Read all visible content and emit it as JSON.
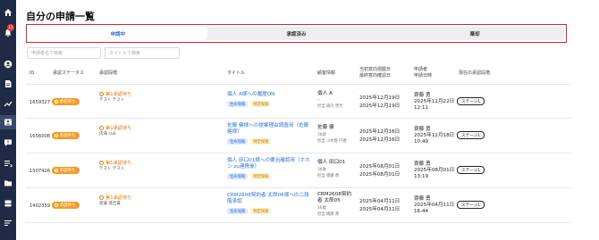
{
  "sidebar": {
    "notification_count": "11",
    "items": [
      {
        "icon": "home-icon"
      },
      {
        "icon": "bell-icon"
      },
      {
        "icon": "user-circle-icon"
      },
      {
        "icon": "document-icon"
      },
      {
        "icon": "trend-chart-icon"
      },
      {
        "icon": "person-card-icon"
      },
      {
        "icon": "chat-alert-icon"
      },
      {
        "icon": "list-icon"
      },
      {
        "icon": "folder-icon"
      },
      {
        "icon": "storage-icon"
      },
      {
        "icon": "filter-list-icon"
      }
    ]
  },
  "page": {
    "title": "自分の申請一覧"
  },
  "tabs": [
    {
      "label": "申請中",
      "active": true
    },
    {
      "label": "承認済み",
      "active": false
    },
    {
      "label": "棄却",
      "active": false
    }
  ],
  "filters": {
    "applicant_placeholder": "申請者名で検索",
    "title_placeholder": "タイトルで検索"
  },
  "table": {
    "headers": {
      "id": "ID",
      "status": "承認ステータス",
      "stage": "承認段階",
      "title": "タイトル",
      "customer": "顧客情報",
      "dates_1": "当初意向把握日",
      "dates_2": "最終意向確認日",
      "applicant_1": "申請者",
      "applicant_2": "申請日時",
      "current_stage": "現在の承認段階"
    },
    "rows": [
      {
        "id": "1659327",
        "status": "承認待ち",
        "stage": "第1承認待ち",
        "stage_sub": "テスト テスト",
        "title": "個人 A様への履歴ON",
        "tags": [
          "生命保険",
          "特定保険"
        ],
        "customer_name": "個人 A",
        "customer_age": "--",
        "customer_rep": "担当 森内 啓代",
        "date1": "2025年12月19日",
        "date2": "2025年12月19日",
        "applicant": "齋藤 勇",
        "applied_date": "2025年12月22日",
        "applied_time": "12:11",
        "current_stage": "ステージ1"
      },
      {
        "id": "1656008",
        "status": "承認待ち",
        "stage": "第1承認待ち",
        "stage_sub": "内海 sub",
        "title": "佐藤 健様への提案理由調査用（佐藤健様）",
        "tags": [
          "生命保険",
          "特定保険"
        ],
        "customer_name": "佐藤 健",
        "customer_age": "36歳",
        "customer_rep": "担当 小木曽 円香",
        "date1": "2025年12月16日",
        "date2": "2025年12月16日",
        "applicant": "齋藤 勇",
        "applied_date": "2025年12月18日",
        "applied_time": "10:49",
        "current_stage": "ステージ1"
      },
      {
        "id": "1507426",
        "status": "承認待ち",
        "stage": "第1承認待ち",
        "stage_sub": "テスト テスト",
        "title": "個人 田口01様への要治確認用（ホカン zu連携後）",
        "tags": [
          "生命保険",
          "特定保険"
        ],
        "customer_name": "個人 田口01",
        "customer_age": "36歳",
        "customer_rep": "担当 齋藤 勇",
        "date1": "2025年08月01日",
        "date2": "2025年08月01日",
        "applicant": "齋藤 勇",
        "applied_date": "2025年08月01日",
        "applied_time": "13:19",
        "current_stage": "ステージ1"
      },
      {
        "id": "1402359",
        "status": "承認待ち",
        "stage": "第1承認待ち",
        "stage_sub": "渡邊 達吉貴",
        "title": "CRM2608契約者 太郎06様への二段階承認",
        "tags": [
          "生命保険",
          "特定保険"
        ],
        "customer_name": "CRM2608契約者 太郎05",
        "customer_age": "36歳",
        "customer_rep": "担当 齋藤 勇",
        "date1": "2025年04月11日",
        "date2": "2025年04月11日",
        "applicant": "齋藤 勇",
        "applied_date": "2025年04月11日",
        "applied_time": "16:44",
        "current_stage": "ステージ1"
      }
    ]
  }
}
